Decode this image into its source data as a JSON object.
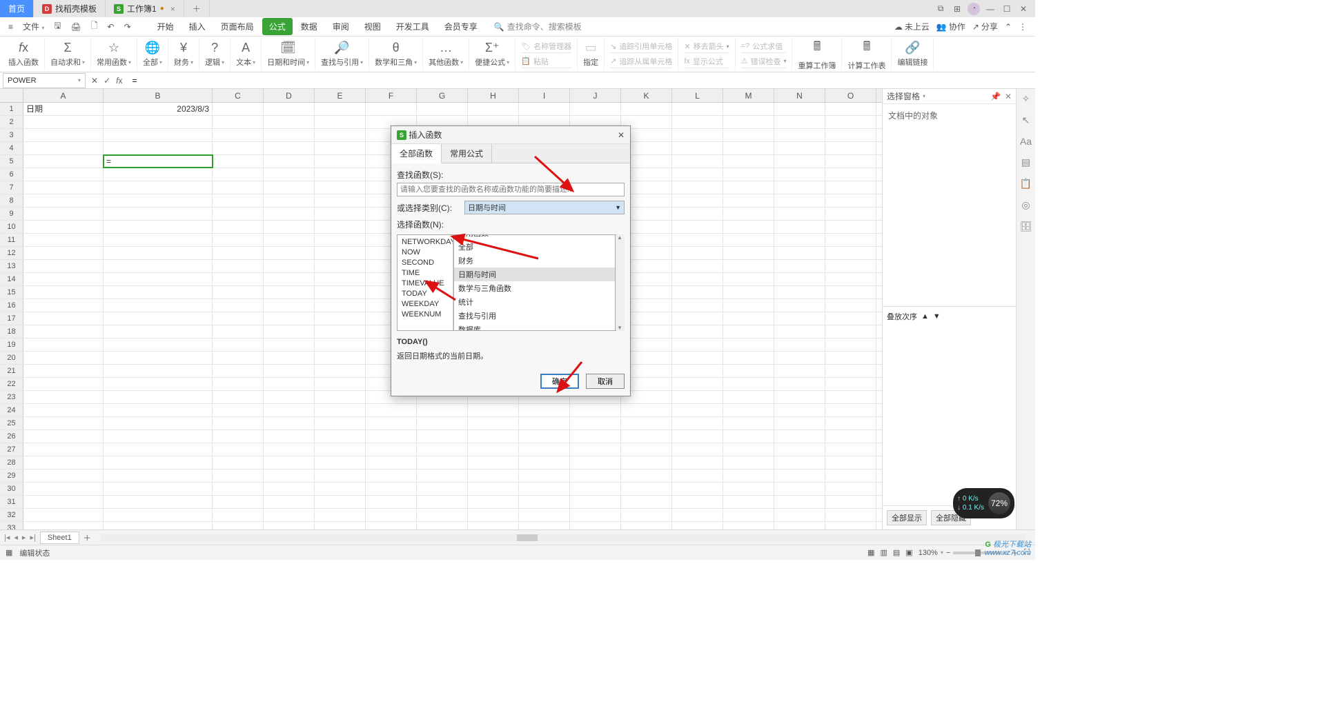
{
  "title_tabs": {
    "home": "首页",
    "template": "找稻壳模板",
    "workbook": "工作簿1"
  },
  "menubar": {
    "file": "文件",
    "start": "开始",
    "insert": "插入",
    "layout": "页面布局",
    "formula": "公式",
    "data": "数据",
    "review": "审阅",
    "view": "视图",
    "dev": "开发工具",
    "member": "会员专享",
    "search": "查找命令、搜索模板"
  },
  "menu_right": {
    "cloud": "未上云",
    "coop": "协作",
    "share": "分享"
  },
  "ribbon": {
    "insert_fn": "插入函数",
    "autosum": "自动求和",
    "common": "常用函数",
    "all": "全部",
    "finance": "财务",
    "logic": "逻辑",
    "text": "文本",
    "datetime": "日期和时间",
    "lookup": "查找与引用",
    "math": "数学和三角",
    "other": "其他函数",
    "quick": "便捷公式",
    "namemgr": "名称管理器",
    "paste": "粘贴",
    "trace_ref": "追踪引用单元格",
    "remove_arrow": "移去箭头",
    "formula_eval": "公式求值",
    "trace_dep": "追踪从属单元格",
    "show_formula": "显示公式",
    "error_check": "错误检查",
    "recalc": "重算工作簿",
    "calc_sheet": "计算工作表",
    "edit_link": "编辑链接",
    "name_ref": "指定"
  },
  "namebox": "POWER",
  "formula": "=",
  "cols": [
    "A",
    "B",
    "C",
    "D",
    "E",
    "F",
    "G",
    "H",
    "I",
    "J",
    "K",
    "L",
    "M",
    "N",
    "O"
  ],
  "cells": {
    "A1": "日期",
    "B1": "2023/8/3",
    "A5_formula": "="
  },
  "taskpane": {
    "title": "选择窗格",
    "body": "文档中的对象"
  },
  "taskpane_foot": {
    "order": "叠放次序",
    "show_all": "全部显示",
    "hide_all": "全部隐藏"
  },
  "sheet": {
    "name": "Sheet1"
  },
  "status": {
    "edit": "编辑状态",
    "zoom": "130%"
  },
  "dialog": {
    "title": "插入函数",
    "tabs": {
      "all": "全部函数",
      "common": "常用公式"
    },
    "search_label": "查找函数(S):",
    "search_placeholder": "请输入您要查找的函数名称或函数功能的简要描述...",
    "category_label": "或选择类别(C):",
    "category_value": "日期与时间",
    "select_label": "选择函数(N):",
    "fns": [
      "NETWORKDAYS",
      "NOW",
      "SECOND",
      "TIME",
      "TIMEVALUE",
      "TODAY",
      "WEEKDAY",
      "WEEKNUM"
    ],
    "categories": [
      "常用函数",
      "全部",
      "财务",
      "日期与时间",
      "数学与三角函数",
      "统计",
      "查找与引用",
      "数据库"
    ],
    "sig": "TODAY()",
    "desc": "返回日期格式的当前日期。",
    "ok": "确定",
    "cancel": "取消"
  },
  "net": {
    "up": "0 K/s",
    "down": "0.1 K/s",
    "pct": "72%"
  },
  "watermark": {
    "brand": "极光下载站",
    "url": "www.xz7.com"
  }
}
